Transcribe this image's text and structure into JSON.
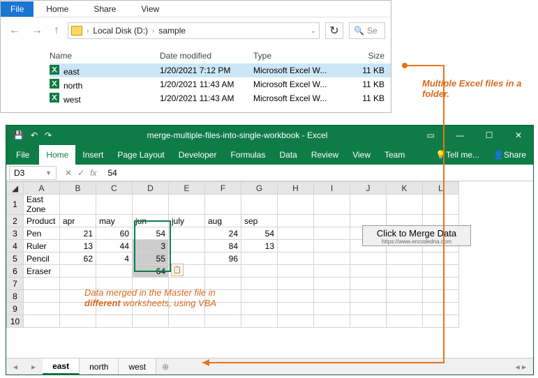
{
  "explorer": {
    "menu": {
      "file": "File",
      "home": "Home",
      "share": "Share",
      "view": "View"
    },
    "breadcrumb": {
      "drive": "Local Disk (D:)",
      "folder": "sample"
    },
    "search_placeholder": "Se",
    "columns": {
      "name": "Name",
      "date": "Date modified",
      "type": "Type",
      "size": "Size"
    },
    "files": [
      {
        "name": "east",
        "date": "1/20/2021 7:12 PM",
        "type": "Microsoft Excel W...",
        "size": "11 KB",
        "selected": true
      },
      {
        "name": "north",
        "date": "1/20/2021 11:43 AM",
        "type": "Microsoft Excel W...",
        "size": "11 KB",
        "selected": false
      },
      {
        "name": "west",
        "date": "1/20/2021 11:43 AM",
        "type": "Microsoft Excel W...",
        "size": "11 KB",
        "selected": false
      }
    ]
  },
  "annotation1": "Multiple Excel files in a folder.",
  "excel": {
    "title": "merge-multiple-files-into-single-workbook - Excel",
    "ribbon": {
      "file": "File",
      "home": "Home",
      "insert": "Insert",
      "pagelayout": "Page Layout",
      "developer": "Developer",
      "formulas": "Formulas",
      "data": "Data",
      "review": "Review",
      "view": "View",
      "team": "Team",
      "tell": "Tell me...",
      "share": "Share"
    },
    "namebox": "D3",
    "formula": "54",
    "columns": [
      "A",
      "B",
      "C",
      "D",
      "E",
      "F",
      "G",
      "H",
      "I",
      "J",
      "K",
      "L"
    ],
    "rows": [
      {
        "r": 1,
        "cells": [
          "East Zone",
          "",
          "",
          "",
          "",
          "",
          "",
          "",
          "",
          "",
          "",
          ""
        ]
      },
      {
        "r": 2,
        "cells": [
          "Product",
          "apr",
          "may",
          "jun",
          "july",
          "aug",
          "sep",
          "",
          "",
          "",
          "",
          ""
        ]
      },
      {
        "r": 3,
        "cells": [
          "Pen",
          "21",
          "60",
          "54",
          "",
          "24",
          "54",
          "",
          "",
          "",
          "",
          ""
        ]
      },
      {
        "r": 4,
        "cells": [
          "Ruler",
          "13",
          "44",
          "3",
          "",
          "84",
          "13",
          "",
          "",
          "",
          "",
          ""
        ]
      },
      {
        "r": 5,
        "cells": [
          "Pencil",
          "62",
          "4",
          "55",
          "",
          "96",
          "",
          "",
          "",
          "",
          "",
          ""
        ]
      },
      {
        "r": 6,
        "cells": [
          "Eraser",
          "",
          "",
          "64",
          "",
          "",
          "",
          "",
          "",
          "",
          "",
          ""
        ]
      },
      {
        "r": 7,
        "cells": [
          "",
          "",
          "",
          "",
          "",
          "",
          "",
          "",
          "",
          "",
          "",
          ""
        ]
      },
      {
        "r": 8,
        "cells": [
          "",
          "",
          "",
          "",
          "",
          "",
          "",
          "",
          "",
          "",
          "",
          ""
        ]
      },
      {
        "r": 9,
        "cells": [
          "",
          "",
          "",
          "",
          "",
          "",
          "",
          "",
          "",
          "",
          "",
          ""
        ]
      },
      {
        "r": 10,
        "cells": [
          "",
          "",
          "",
          "",
          "",
          "",
          "",
          "",
          "",
          "",
          "",
          ""
        ]
      }
    ],
    "merge_button": "Click to Merge Data",
    "merge_url": "https://www.encodedna.com",
    "annotation2_1": "Data merged in the Master file in",
    "annotation2_2": "different",
    "annotation2_3": " worksheets, using VBA",
    "sheets": [
      "east",
      "north",
      "west"
    ]
  }
}
